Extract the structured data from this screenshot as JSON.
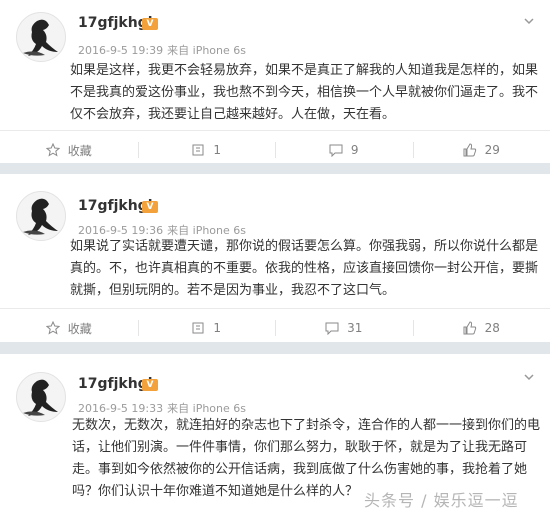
{
  "posts": [
    {
      "username": "17gfjkhgh",
      "time": "2016-9-5 19:39",
      "source": "来自 iPhone 6s",
      "text": "如果是这样，我更不会轻易放弃，如果不是真正了解我的人知道我是怎样的，如果不是我真的爱这份事业，我也熬不到今天，相信换一个人早就被你们逼走了。我不仅不会放弃，我还要让自己越来越好。人在做，天在看。",
      "actions": {
        "favorite": "收藏",
        "repost": "1",
        "comment": "9",
        "like": "29"
      }
    },
    {
      "username": "17gfjkhgh",
      "time": "2016-9-5 19:36",
      "source": "来自 iPhone 6s",
      "text": "如果说了实话就要遭天谴，那你说的假话要怎么算。你强我弱，所以你说什么都是真的。不，也许真相真的不重要。依我的性格，应该直接回馈你一封公开信，要撕就撕，但别玩阴的。若不是因为事业，我忍不了这口气。",
      "actions": {
        "favorite": "收藏",
        "repost": "1",
        "comment": "31",
        "like": "28"
      }
    },
    {
      "username": "17gfjkhgh",
      "time": "2016-9-5 19:33",
      "source": "来自 iPhone 6s",
      "text": "无数次，无数次，就连拍好的杂志也下了封杀令，连合作的人都一一接到你们的电话，让他们别演。一件件事情，你们那么努力，耿耿于怀，就是为了让我无路可走。事到如今依然被你的公开信话病，我到底做了什么伤害她的事，我抢着了她吗？你们认识十年你难道不知道她是什么样的人？",
      "actions": {
        "favorite": "",
        "repost": "",
        "comment": "",
        "like": ""
      }
    }
  ],
  "watermark": "头条号 / 娱乐逗一逗",
  "colors": {
    "background": "#f2f2f5",
    "separator": "#e1e6ea",
    "meta": "#9b9b9b",
    "vip": "#f3a13a"
  }
}
